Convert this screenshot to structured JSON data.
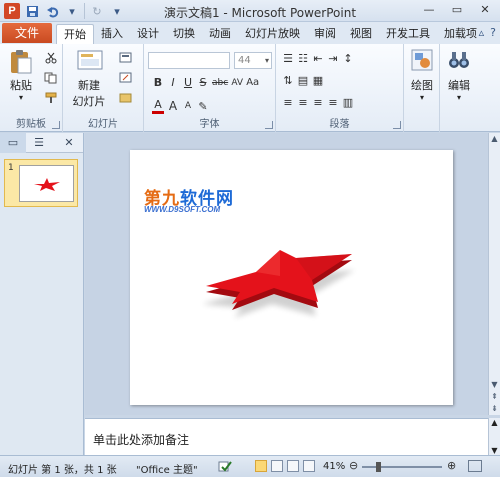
{
  "window": {
    "title": "演示文稿1 - Microsoft PowerPoint",
    "app_icon_letter": "P",
    "controls": [
      "—",
      "▭",
      "✕"
    ]
  },
  "qat": {
    "icons": [
      "save-icon",
      "undo-icon",
      "redo-icon",
      "customize-icon"
    ]
  },
  "ribbon_tabs": {
    "file": "文件",
    "items": [
      "开始",
      "插入",
      "设计",
      "切换",
      "动画",
      "幻灯片放映",
      "审阅",
      "视图",
      "开发工具",
      "加载项"
    ],
    "active": "开始"
  },
  "ribbon": {
    "clipboard": {
      "paste_label": "粘贴",
      "group_label": "剪贴板"
    },
    "slides": {
      "new_slide_label_1": "新建",
      "new_slide_label_2": "幻灯片",
      "group_label": "幻灯片"
    },
    "font": {
      "font_name": "",
      "font_size": "44",
      "group_label": "字体",
      "row2": [
        "B",
        "I",
        "U",
        "S",
        "abc",
        "AV",
        "Aa"
      ],
      "row3": [
        "A",
        "A",
        "A"
      ]
    },
    "paragraph": {
      "group_label": "段落"
    },
    "drawing": {
      "label": "绘图"
    },
    "editing": {
      "label": "编辑"
    }
  },
  "slides_pane": {
    "tabs": [
      "▭",
      "☰"
    ],
    "close": "✕",
    "thumbnail_number": "1"
  },
  "slide": {
    "watermark_title_orange": "第九",
    "watermark_title_blue": "软件网",
    "watermark_url": "WWW.D9SOFT.COM"
  },
  "notes": {
    "placeholder": "单击此处添加备注"
  },
  "status": {
    "slide_info": "幻灯片 第 1 张，共 1 张",
    "theme": "\"Office 主题\"",
    "zoom": "41%",
    "zoom_level": 0.41
  },
  "colors": {
    "accent": "#d24726",
    "star": "#e4121b"
  }
}
